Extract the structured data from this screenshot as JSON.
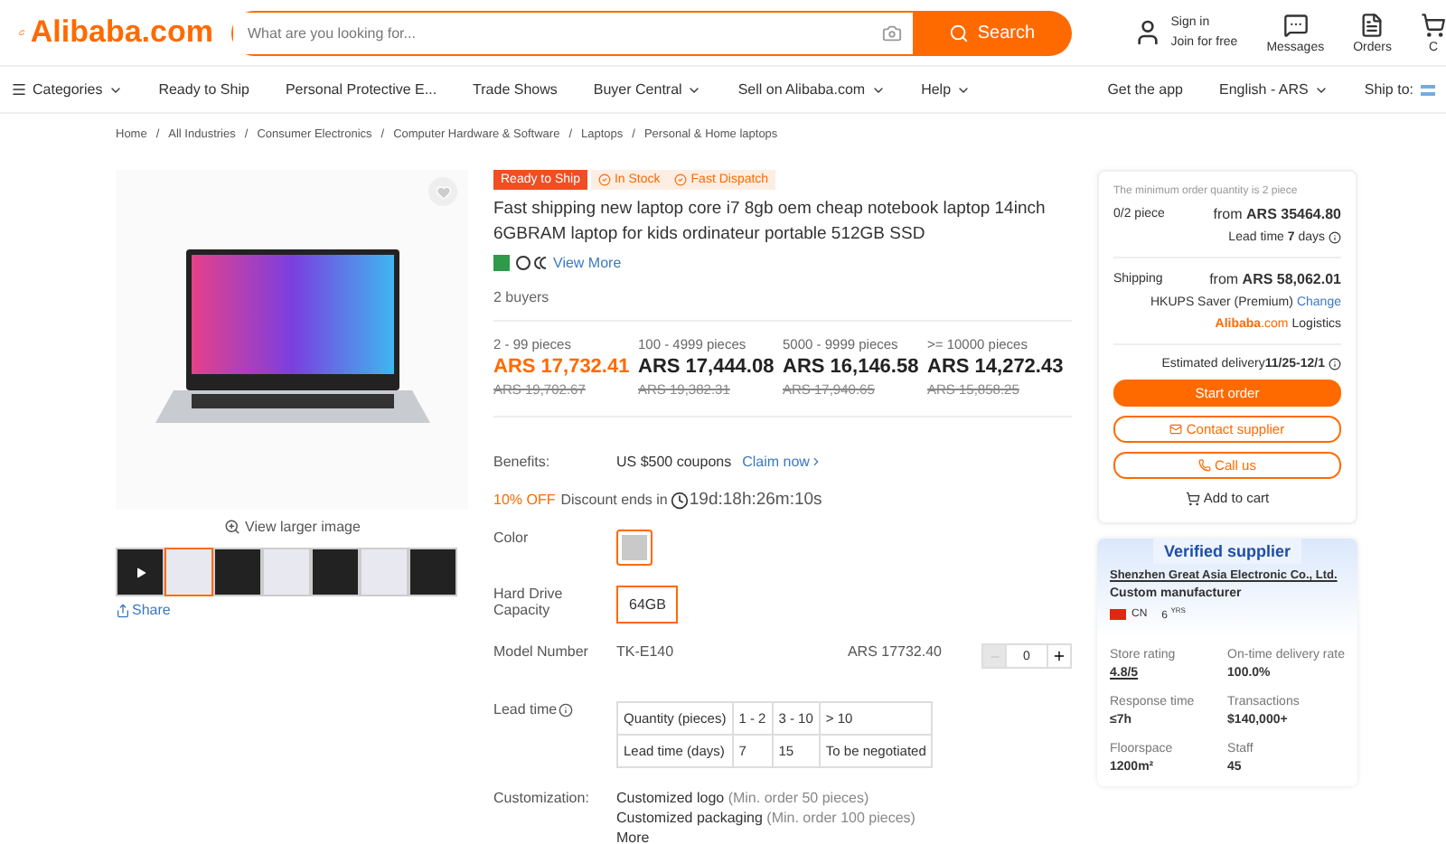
{
  "header": {
    "logo": "Alibaba.com",
    "search": {
      "placeholder": "What are you looking for...",
      "button": "Search"
    },
    "account": {
      "line1": "Sign in",
      "line2": "Join for free"
    },
    "actions": [
      {
        "kind": "messages",
        "label": "Messages"
      },
      {
        "kind": "orders",
        "label": "Orders"
      },
      {
        "kind": "cart",
        "label": "C"
      }
    ]
  },
  "nav": {
    "items": [
      {
        "label": "Categories",
        "kind": "menu",
        "dropdown": true
      },
      {
        "label": "Ready to Ship",
        "kind": "link",
        "dropdown": false
      },
      {
        "label": "Personal Protective E...",
        "kind": "link",
        "dropdown": false
      },
      {
        "label": "Trade Shows",
        "kind": "link",
        "dropdown": false
      },
      {
        "label": "Buyer Central",
        "kind": "link",
        "dropdown": true
      },
      {
        "label": "Sell on Alibaba.com",
        "kind": "link",
        "dropdown": true
      },
      {
        "label": "Help",
        "kind": "link",
        "dropdown": true
      }
    ],
    "right": [
      {
        "label": "Get the app",
        "dropdown": false
      },
      {
        "label": "English - ARS",
        "dropdown": true
      },
      {
        "label": "Ship to:",
        "dropdown": false
      }
    ]
  },
  "breadcrumb_separator": "/",
  "breadcrumbs": [
    "Home",
    "All Industries",
    "Consumer Electronics",
    "Computer Hardware & Software",
    "Laptops",
    "Personal & Home laptops"
  ],
  "gallery": {
    "view_larger": "View larger image",
    "share": "Share",
    "thumbnails": [
      {
        "kind": "video",
        "selected": false
      },
      {
        "kind": "photo",
        "selected": true
      },
      {
        "kind": "photo",
        "selected": false
      },
      {
        "kind": "photo",
        "selected": false
      },
      {
        "kind": "photo",
        "selected": false
      },
      {
        "kind": "photo",
        "selected": false
      },
      {
        "kind": "photo",
        "selected": false
      }
    ]
  },
  "product": {
    "badges": [
      {
        "kind": "solid",
        "label": "Ready to Ship"
      },
      {
        "kind": "check",
        "label": "In Stock"
      },
      {
        "kind": "check",
        "label": "Fast Dispatch"
      }
    ],
    "title": "Fast shipping new laptop core i7 8gb oem cheap notebook laptop 14inch 6GBRAM laptop for kids ordinateur portable 512GB SSD",
    "view_more": "View More",
    "buyers": "2 buyers",
    "tiers": [
      {
        "range": "2 - 99 pieces",
        "price": "ARS 17,732.41",
        "original": "ARS 19,702.67",
        "selected": true
      },
      {
        "range": "100 - 4999 pieces",
        "price": "ARS 17,444.08",
        "original": "ARS 19,382.31",
        "selected": false
      },
      {
        "range": "5000 - 9999 pieces",
        "price": "ARS 16,146.58",
        "original": "ARS 17,940.65",
        "selected": false
      },
      {
        "range": ">= 10000 pieces",
        "price": "ARS 14,272.43",
        "original": "ARS 15,858.25",
        "selected": false
      }
    ],
    "benefits": {
      "label": "Benefits:",
      "text": "US $500 coupons",
      "link": "Claim now"
    },
    "discount": {
      "badge": "10% OFF",
      "text": "Discount ends in",
      "countdown": "19d:18h:26m:10s"
    },
    "color": {
      "label": "Color",
      "selected": true
    },
    "storage": {
      "label": "Hard Drive Capacity",
      "option": "64GB",
      "selected": true
    },
    "model": {
      "label": "Model Number",
      "value": "TK-E140",
      "price": "ARS 17732.40",
      "quantity": "0",
      "minus_disabled": true
    },
    "lead_time": {
      "label": "Lead time",
      "rows": [
        [
          "Quantity (pieces)",
          "1 - 2",
          "3 - 10",
          "> 10"
        ],
        [
          "Lead time (days)",
          "7",
          "15",
          "To be negotiated"
        ]
      ]
    },
    "customization": {
      "label": "Customization:",
      "items": [
        {
          "name": "Customized logo",
          "note": "(Min. order 50 pieces)"
        },
        {
          "name": "Customized packaging",
          "note": "(Min. order 100 pieces)"
        }
      ],
      "more": "More"
    }
  },
  "order_panel": {
    "min_note": "The minimum order quantity is 2 piece",
    "count": "0/2 piece",
    "price": "from **ARS 35464.80**",
    "lead": "Lead time **7** days",
    "shipping_label": "Shipping",
    "shipping_price": "from **ARS 58,062.01**",
    "service": "HKUPS Saver (Premium)",
    "change": "Change",
    "logistics_brand": "Alibaba",
    "logistics_domain": ".com",
    "logistics": "Logistics",
    "delivery": "Estimated delivery**11/25-12/1**",
    "start": "Start order",
    "contact": "Contact supplier",
    "call": "Call us",
    "cart": "Add to cart"
  },
  "supplier": {
    "badge": "Verified supplier",
    "name": "Shenzhen Great Asia Electronic Co., Ltd.",
    "type": "Custom manufacturer",
    "country": "CN",
    "years": "6",
    "years_unit": "YRS",
    "stats": [
      {
        "label": "Store rating",
        "value": "4.8/5",
        "link": true
      },
      {
        "label": "On-time delivery rate",
        "value": "100.0%",
        "link": false
      },
      {
        "label": "Response time",
        "value": "≤7h",
        "link": false
      },
      {
        "label": "Transactions",
        "value": "$140,000+",
        "link": false
      },
      {
        "label": "Floorspace",
        "value": "1200m²",
        "link": false
      },
      {
        "label": "Staff",
        "value": "45",
        "link": false
      }
    ]
  }
}
